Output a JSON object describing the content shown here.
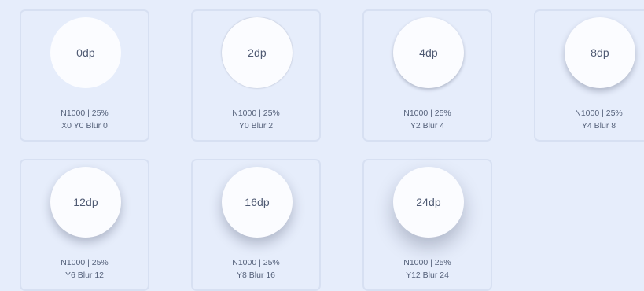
{
  "elevations": [
    {
      "label": "0dp",
      "line1": "N1000 | 25%",
      "line2": "X0 Y0 Blur 0"
    },
    {
      "label": "2dp",
      "line1": "N1000 | 25%",
      "line2": "Y0 Blur 2"
    },
    {
      "label": "4dp",
      "line1": "N1000 | 25%",
      "line2": "Y2 Blur 4"
    },
    {
      "label": "8dp",
      "line1": "N1000 | 25%",
      "line2": "Y4 Blur 8"
    },
    {
      "label": "12dp",
      "line1": "N1000 | 25%",
      "line2": "Y6 Blur 12"
    },
    {
      "label": "16dp",
      "line1": "N1000 | 25%",
      "line2": "Y8 Blur 16"
    },
    {
      "label": "24dp",
      "line1": "N1000 | 25%",
      "line2": "Y12 Blur 24"
    }
  ],
  "colors": {
    "background": "#e6edfb",
    "card_border": "#d7e0f2",
    "circle_fill": "#fbfcff",
    "text": "#4f5a73"
  }
}
